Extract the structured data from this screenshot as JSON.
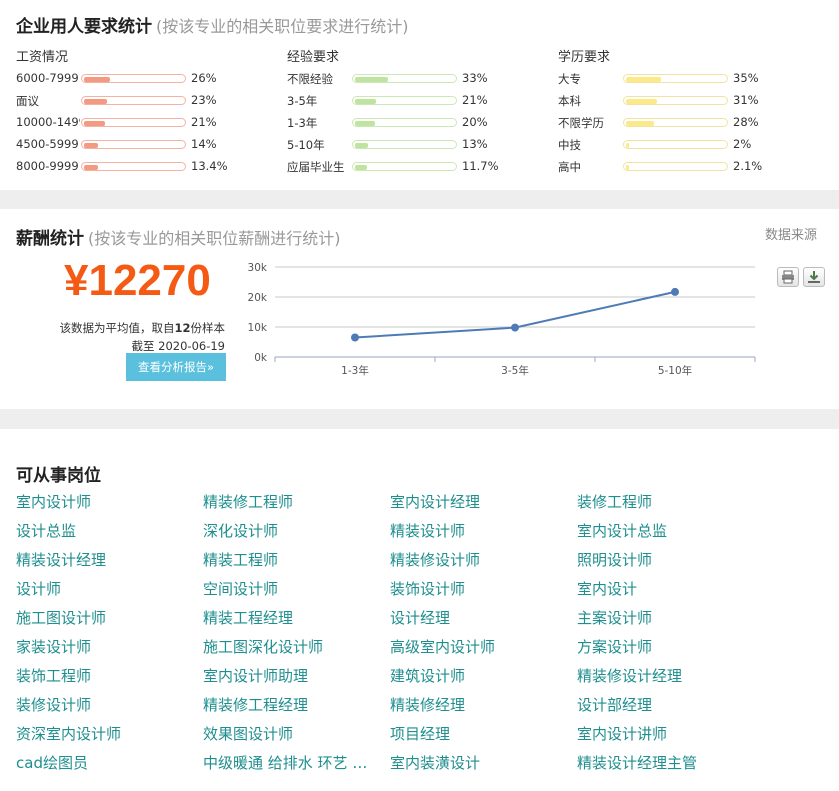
{
  "stats": {
    "title": "企业用人要求统计",
    "subtitle": "(按该专业的相关职位要求进行统计)",
    "columns": [
      {
        "title": "工资情况",
        "color": "#f49a82",
        "border": "#f3b3a3",
        "rows": [
          {
            "label": "6000-7999",
            "pct_text": "26%",
            "value": 26
          },
          {
            "label": "面议",
            "pct_text": "23%",
            "value": 23
          },
          {
            "label": "10000-14999",
            "pct_text": "21%",
            "value": 21
          },
          {
            "label": "4500-5999",
            "pct_text": "14%",
            "value": 14
          },
          {
            "label": "8000-9999",
            "pct_text": "13.4%",
            "value": 13.4
          }
        ]
      },
      {
        "title": "经验要求",
        "color": "#bfe3a0",
        "border": "#cde8b4",
        "rows": [
          {
            "label": "不限经验",
            "pct_text": "33%",
            "value": 33
          },
          {
            "label": "3-5年",
            "pct_text": "21%",
            "value": 21
          },
          {
            "label": "1-3年",
            "pct_text": "20%",
            "value": 20
          },
          {
            "label": "5-10年",
            "pct_text": "13%",
            "value": 13
          },
          {
            "label": "应届毕业生",
            "pct_text": "11.7%",
            "value": 11.7
          }
        ]
      },
      {
        "title": "学历要求",
        "color": "#fbe98a",
        "border": "#f3e3a0",
        "rows": [
          {
            "label": "大专",
            "pct_text": "35%",
            "value": 35
          },
          {
            "label": "本科",
            "pct_text": "31%",
            "value": 31
          },
          {
            "label": "不限学历",
            "pct_text": "28%",
            "value": 28
          },
          {
            "label": "中技",
            "pct_text": "2%",
            "value": 2
          },
          {
            "label": "高中",
            "pct_text": "2.1%",
            "value": 2.1
          }
        ]
      }
    ]
  },
  "salary": {
    "title": "薪酬统计",
    "subtitle": "(按该专业的相关职位薪酬进行统计)",
    "source_link": "数据来源",
    "amount": "¥12270",
    "note_prefix": "该数据为平均值，取自",
    "sample_count": "12",
    "note_suffix": "份样本",
    "date_note": "截至 2020-06-19",
    "report_button": "查看分析报告»",
    "accent_color": "#f55a14",
    "button_color": "#5bc0de",
    "tools": [
      "print-icon",
      "download-icon"
    ]
  },
  "chart_data": {
    "type": "line",
    "categories": [
      "1-3年",
      "3-5年",
      "5-10年"
    ],
    "series": [
      {
        "values": [
          6500,
          9800,
          21700
        ]
      }
    ],
    "y_ticks": [
      "0k",
      "10k",
      "20k",
      "30k"
    ],
    "ylim": [
      0,
      30000
    ],
    "grid": true,
    "line_color": "#4e7bb6"
  },
  "jobs": {
    "title": "可从事岗位",
    "items": [
      "室内设计师",
      "精装修工程师",
      "室内设计经理",
      "装修工程师",
      "设计总监",
      "深化设计师",
      "精装设计师",
      "室内设计总监",
      "精装设计经理",
      "精装工程师",
      "精装修设计师",
      "照明设计师",
      "设计师",
      "空间设计师",
      "装饰设计师",
      "室内设计",
      "施工图设计师",
      "精装工程经理",
      "设计经理",
      "主案设计师",
      "家装设计师",
      "施工图深化设计师",
      "高级室内设计师",
      "方案设计师",
      "装饰工程师",
      "室内设计师助理",
      "建筑设计师",
      "精装修设计经理",
      "装修设计师",
      "精装修工程经理",
      "精装修经理",
      "设计部经理",
      "资深室内设计师",
      "效果图设计师",
      "项目经理",
      "室内设计讲师",
      "cad绘图员",
      "中级暖通 给排水 环艺 施工员",
      "室内装潢设计",
      "精装设计经理主管"
    ]
  }
}
